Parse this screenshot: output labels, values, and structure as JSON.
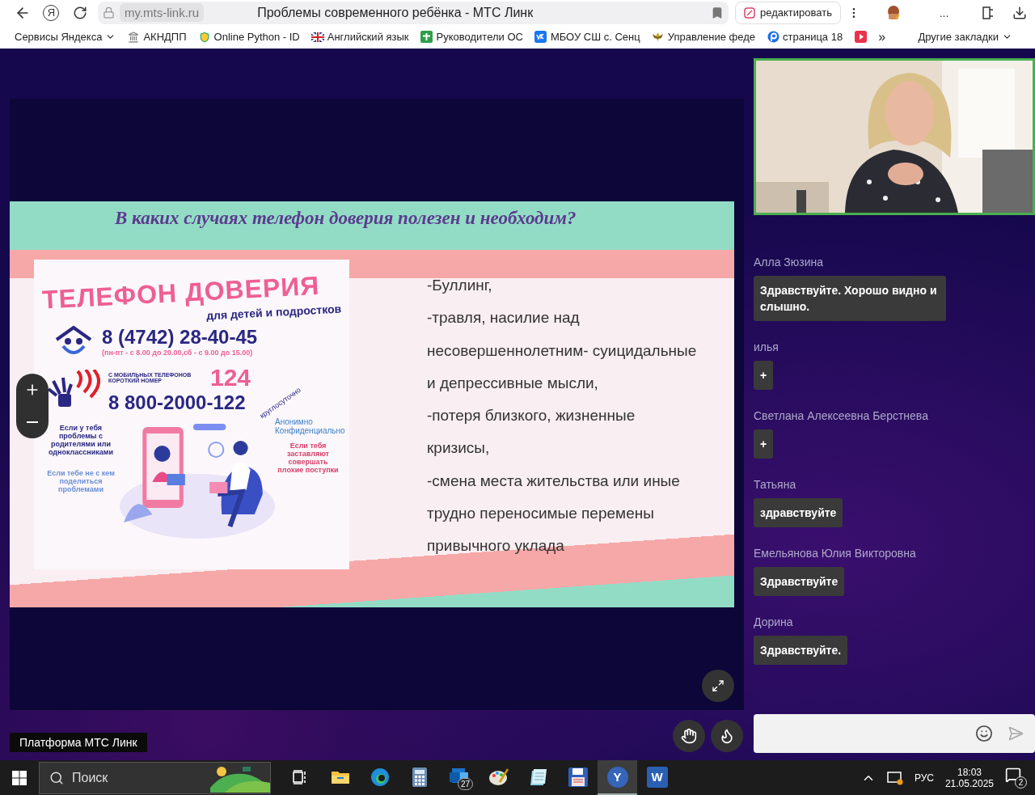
{
  "browser": {
    "home_label": "Я",
    "url": "my.mts-link.ru",
    "title": "Проблемы современного ребёнка - МТС Линк",
    "edit_button": "редактировать",
    "more": "...",
    "bookmarks": [
      {
        "label": "Сервисы Яндекса",
        "kind": "menu"
      },
      {
        "label": "АКНДПП",
        "kind": "bank"
      },
      {
        "label": "Online Python - ID",
        "kind": "shield"
      },
      {
        "label": "Английский язык",
        "kind": "flag"
      },
      {
        "label": "Руководители ОС",
        "kind": "plus"
      },
      {
        "label": "МБОУ СШ с. Сенц",
        "kind": "vk"
      },
      {
        "label": "Управление феде",
        "kind": "emblem"
      },
      {
        "label": "страница 18",
        "kind": "p"
      },
      {
        "kind": "video"
      }
    ],
    "overflow": "»",
    "other_bookmarks": "Другие закладки"
  },
  "slide": {
    "title": "В каких случаях телефон доверия полезен и необходим?",
    "poster": {
      "heading": "ТЕЛЕФОН ДОВЕРИЯ",
      "subheading": "для детей и подростков",
      "phone": "8 (4742) 28-40-45",
      "hours": "(пн-пт - с 8.00 до 20.00,сб - с 9.00 до 15.00)",
      "mobile_note": "С МОБИЛЬНЫХ ТЕЛЕФОНОВ КОРОТКИЙ НОМЕР",
      "short_number": "124",
      "hotline": "8 800-2000-122",
      "round_clock": "круглосуточно",
      "anonymous": "Анонимно",
      "confidential": "Конфиденциально",
      "case_1": "Если у тебя проблемы с родителями или одноклассниками",
      "case_2": "Если тебе не с кем поделиться проблемами",
      "case_3": "Если тебя заставляют совершать плохие поступки"
    },
    "bullets": [
      "-Буллинг,",
      "-травля, насилие над",
      "несовершеннолетним- суицидальные",
      "и депрессивные мысли,",
      "-потеря близкого, жизненные",
      "кризисы,",
      " -смена места жительства или иные",
      "трудно переносимые перемены",
      "привычного уклада"
    ]
  },
  "platform_label": "Платформа МТС Линк",
  "chat": {
    "messages": [
      {
        "author": "Алла Зюзина",
        "text": "Здравствуйте. Хорошо видно и слышно."
      },
      {
        "author": "илья",
        "text": "+"
      },
      {
        "author": "Светлана Алексеевна Берстнева",
        "text": "+"
      },
      {
        "author": "Татьяна",
        "text": "здравствуйте"
      },
      {
        "author": "Емельянова Юлия Викторовна",
        "text": "Здравствуйте"
      },
      {
        "author": "Дорина",
        "text": "Здравствуйте."
      }
    ]
  },
  "taskbar": {
    "search_placeholder": "Поиск",
    "apps": [
      {
        "kind": "taskview",
        "selected": false
      },
      {
        "kind": "folder",
        "selected": false
      },
      {
        "kind": "edge",
        "selected": false
      },
      {
        "kind": "calculator",
        "selected": false
      },
      {
        "kind": "outlook",
        "selected": false,
        "badge": "27"
      },
      {
        "kind": "paint",
        "selected": false
      },
      {
        "kind": "notepad",
        "selected": false
      },
      {
        "kind": "floppy",
        "selected": false
      },
      {
        "kind": "yandex",
        "selected": true,
        "letter": "Y"
      },
      {
        "kind": "word",
        "selected": false,
        "letter": "W"
      }
    ],
    "language": "РУС",
    "time": "18:03",
    "date": "21.05.2025",
    "notifications": "2"
  }
}
